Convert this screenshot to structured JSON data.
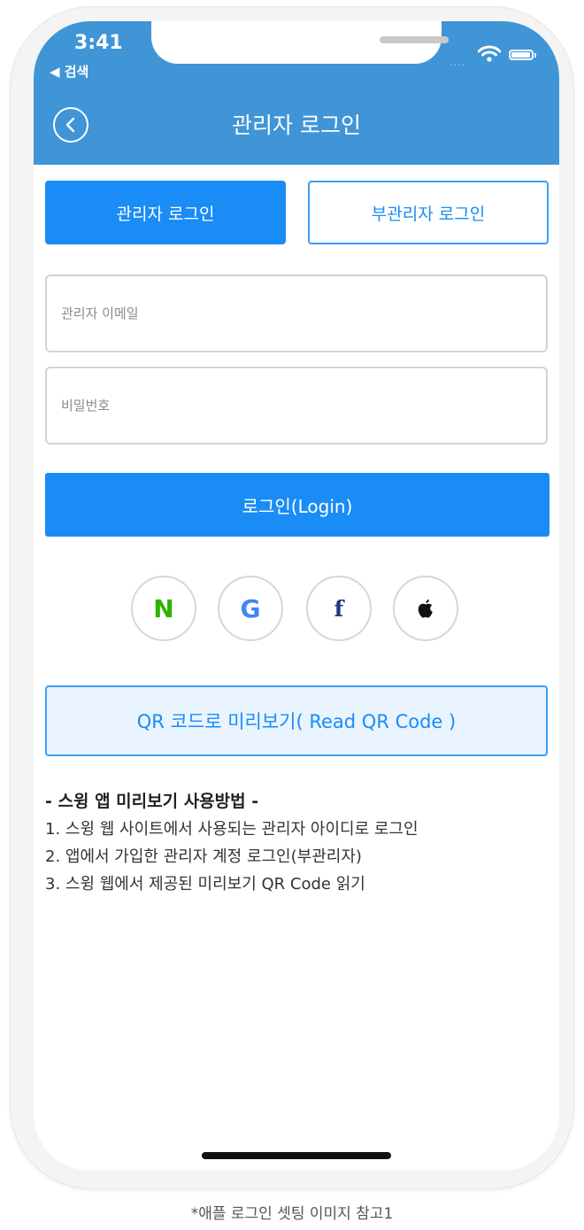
{
  "status_bar": {
    "time": "3:41",
    "back_app": "◀ 검색",
    "signal_dots": "....",
    "icons": [
      "wifi-icon",
      "battery-icon"
    ]
  },
  "nav": {
    "title": "관리자 로그인",
    "back_icon": "chevron-left-circle-icon"
  },
  "tabs": {
    "admin_label": "관리자 로그인",
    "sub_admin_label": "부관리자 로그인",
    "active": "admin"
  },
  "form": {
    "email_placeholder": "관리자 이메일",
    "password_placeholder": "비밀번호",
    "login_label": "로그인(Login)"
  },
  "social": {
    "naver": "N",
    "google": "G",
    "facebook": "f",
    "apple_icon": "apple-icon"
  },
  "qr": {
    "label": "QR 코드로 미리보기( Read QR Code )"
  },
  "help": {
    "title": "- 스윙 앱 미리보기 사용방법 -",
    "lines": [
      "1. 스윙 웹 사이트에서 사용되는 관리자 아이디로 로그인",
      "2. 앱에서 가입한 관리자 계정 로그인(부관리자)",
      "3. 스윙 웹에서 제공된 미리보기 QR Code 읽기"
    ]
  },
  "caption": "*애플 로그인 셋팅 이미지 참고1",
  "colors": {
    "header": "#3f95d6",
    "primary": "#1a8cf5",
    "qr_bg": "#e9f4fe",
    "naver": "#2db400",
    "facebook": "#1c3a7a"
  }
}
